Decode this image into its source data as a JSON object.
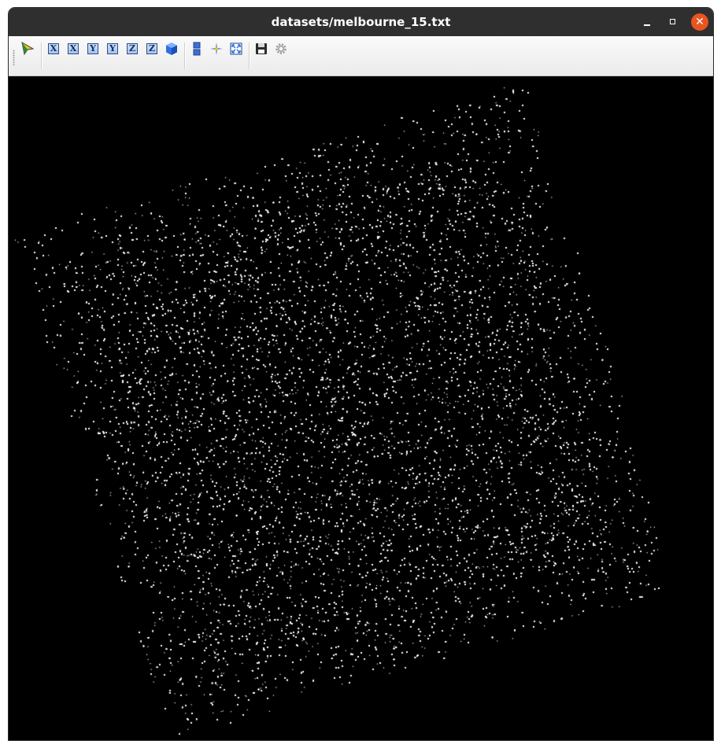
{
  "window": {
    "title": "datasets/melbourne_15.txt",
    "controls": {
      "minimize": "–",
      "maximize": "□",
      "close": "✕"
    },
    "close_color": "#e95420",
    "titlebar_color": "#2f2f2f"
  },
  "toolbar": {
    "buttons": [
      {
        "name": "pick-tool",
        "icon": "arrow-pointer-icon"
      },
      {
        "name": "view-x-plus",
        "icon": "x-axis-icon",
        "label": "X"
      },
      {
        "name": "view-x-minus",
        "icon": "x-axis-icon",
        "label": "X"
      },
      {
        "name": "view-y-plus",
        "icon": "y-axis-icon",
        "label": "Y"
      },
      {
        "name": "view-y-minus",
        "icon": "y-axis-icon",
        "label": "Y"
      },
      {
        "name": "view-z-plus",
        "icon": "z-axis-icon",
        "label": "Z"
      },
      {
        "name": "view-z-minus",
        "icon": "z-axis-icon",
        "label": "Z"
      },
      {
        "name": "view-3d",
        "icon": "cube-icon"
      },
      {
        "name": "color-map",
        "icon": "colorbar-icon"
      },
      {
        "name": "reset-center",
        "icon": "star-center-icon"
      },
      {
        "name": "zoom-fit",
        "icon": "fit-screen-icon"
      },
      {
        "name": "save",
        "icon": "floppy-disk-icon"
      },
      {
        "name": "settings",
        "icon": "gear-icon"
      }
    ]
  },
  "viewport": {
    "background": "#000000",
    "point_color": "#ffffff"
  }
}
